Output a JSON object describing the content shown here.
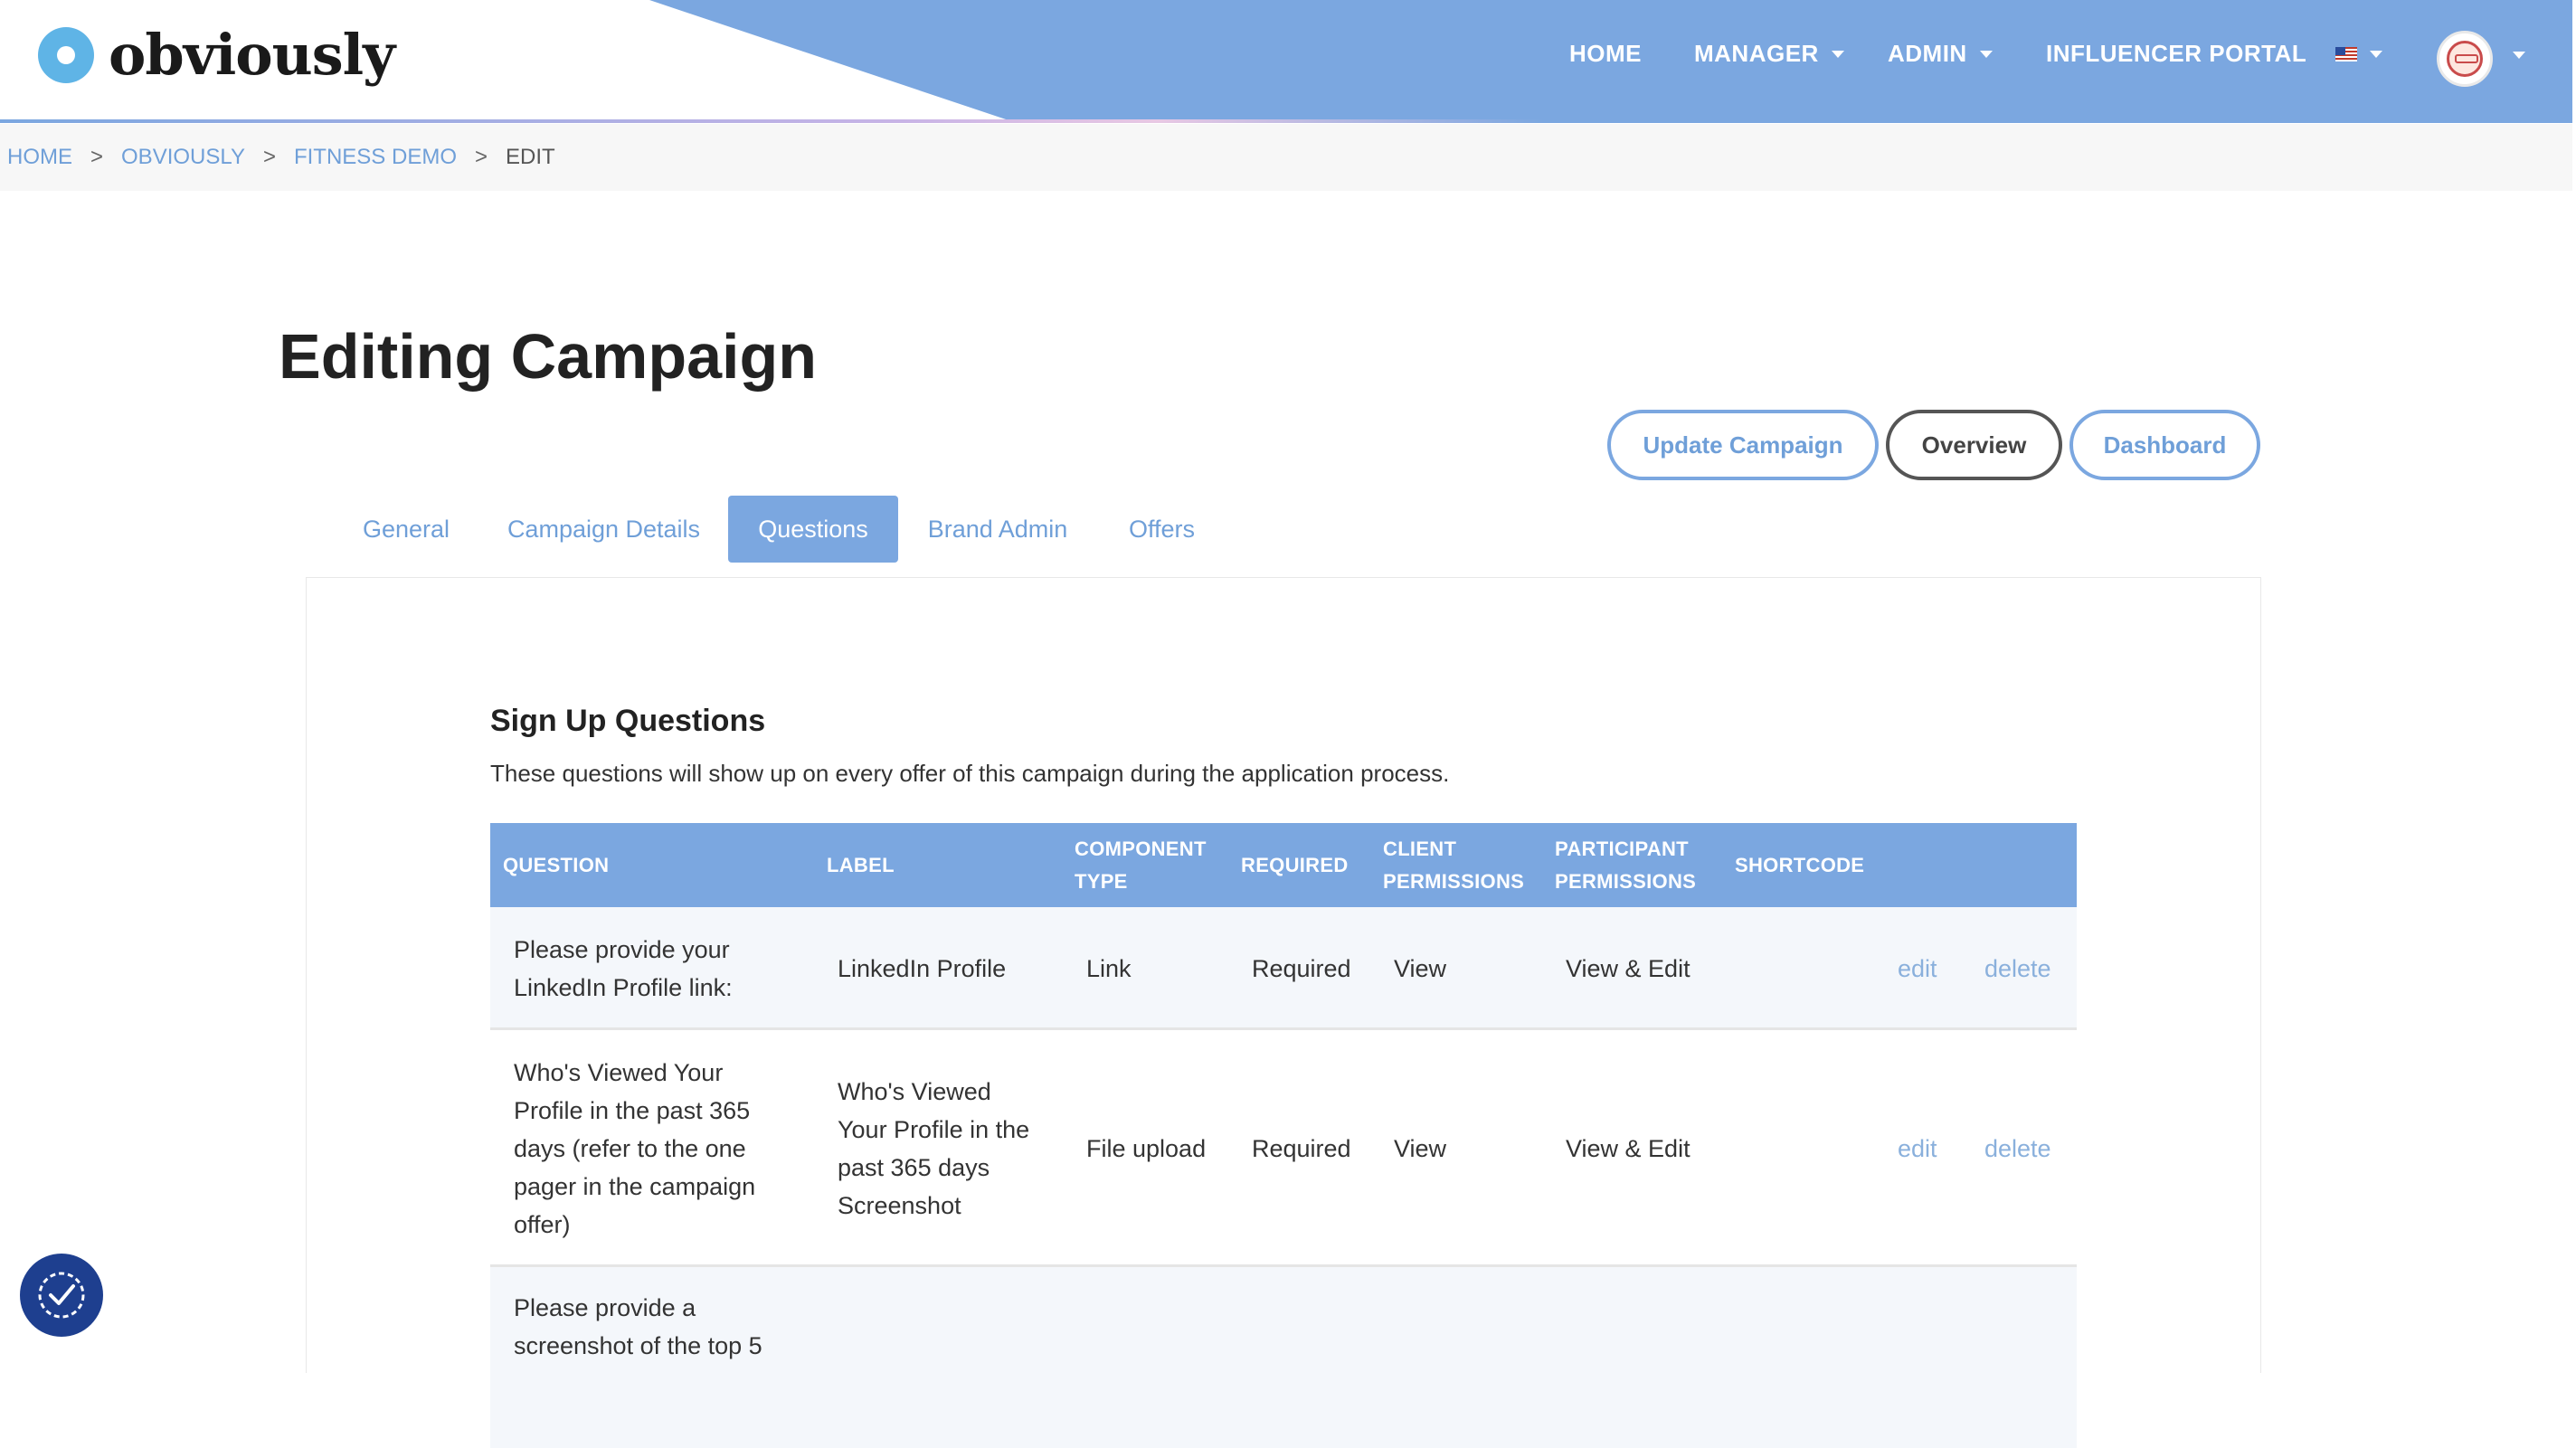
{
  "header": {
    "logo_text": "obviously",
    "nav": {
      "home": "HOME",
      "manager": "MANAGER",
      "admin": "ADMIN",
      "influencer_portal": "INFLUENCER PORTAL"
    },
    "language_icon": "us-flag-icon",
    "avatar_icon": "user-avatar-icon"
  },
  "breadcrumb": {
    "items": [
      "HOME",
      "OBVIOUSLY",
      "FITNESS DEMO"
    ],
    "separator": ">",
    "current": "EDIT"
  },
  "page": {
    "title": "Editing Campaign",
    "buttons": {
      "update": "Update Campaign",
      "overview": "Overview",
      "dashboard": "Dashboard"
    },
    "tabs": [
      "General",
      "Campaign Details",
      "Questions",
      "Brand Admin",
      "Offers"
    ],
    "active_tab": "Questions"
  },
  "section": {
    "title": "Sign Up Questions",
    "description": "These questions will show up on every offer of this campaign during the application process."
  },
  "table": {
    "headers": {
      "question": "QUESTION",
      "label": "LABEL",
      "component_line1": "COMPONENT",
      "component_line2": "TYPE",
      "required": "REQUIRED",
      "client_line1": "CLIENT",
      "client_line2": "PERMISSIONS",
      "participant_line1": "PARTICIPANT",
      "participant_line2": "PERMISSIONS",
      "shortcode": "SHORTCODE"
    },
    "rows": [
      {
        "question": [
          "Please provide your",
          "LinkedIn Profile link:"
        ],
        "label": [
          "LinkedIn Profile"
        ],
        "component": "Link",
        "required": "Required",
        "client": "View",
        "participant": "View & Edit",
        "shortcode": "",
        "edit": "edit",
        "delete": "delete"
      },
      {
        "question": [
          "Who's Viewed Your",
          "Profile in the past 365",
          "days (refer to the one",
          "pager in the campaign",
          "offer)"
        ],
        "label": [
          "Who's Viewed",
          "Your Profile in the",
          "past 365 days",
          "Screenshot"
        ],
        "component": "File upload",
        "required": "Required",
        "client": "View",
        "participant": "View & Edit",
        "shortcode": "",
        "edit": "edit",
        "delete": "delete"
      },
      {
        "question": [
          "Please provide a",
          "screenshot of the top 5"
        ]
      }
    ]
  },
  "colors": {
    "primary": "#7ba7e0",
    "link": "#6f9fd8",
    "accessibility_button": "#1e3f8f"
  },
  "floating": {
    "accessibility_icon": "accessibility-check-icon"
  }
}
